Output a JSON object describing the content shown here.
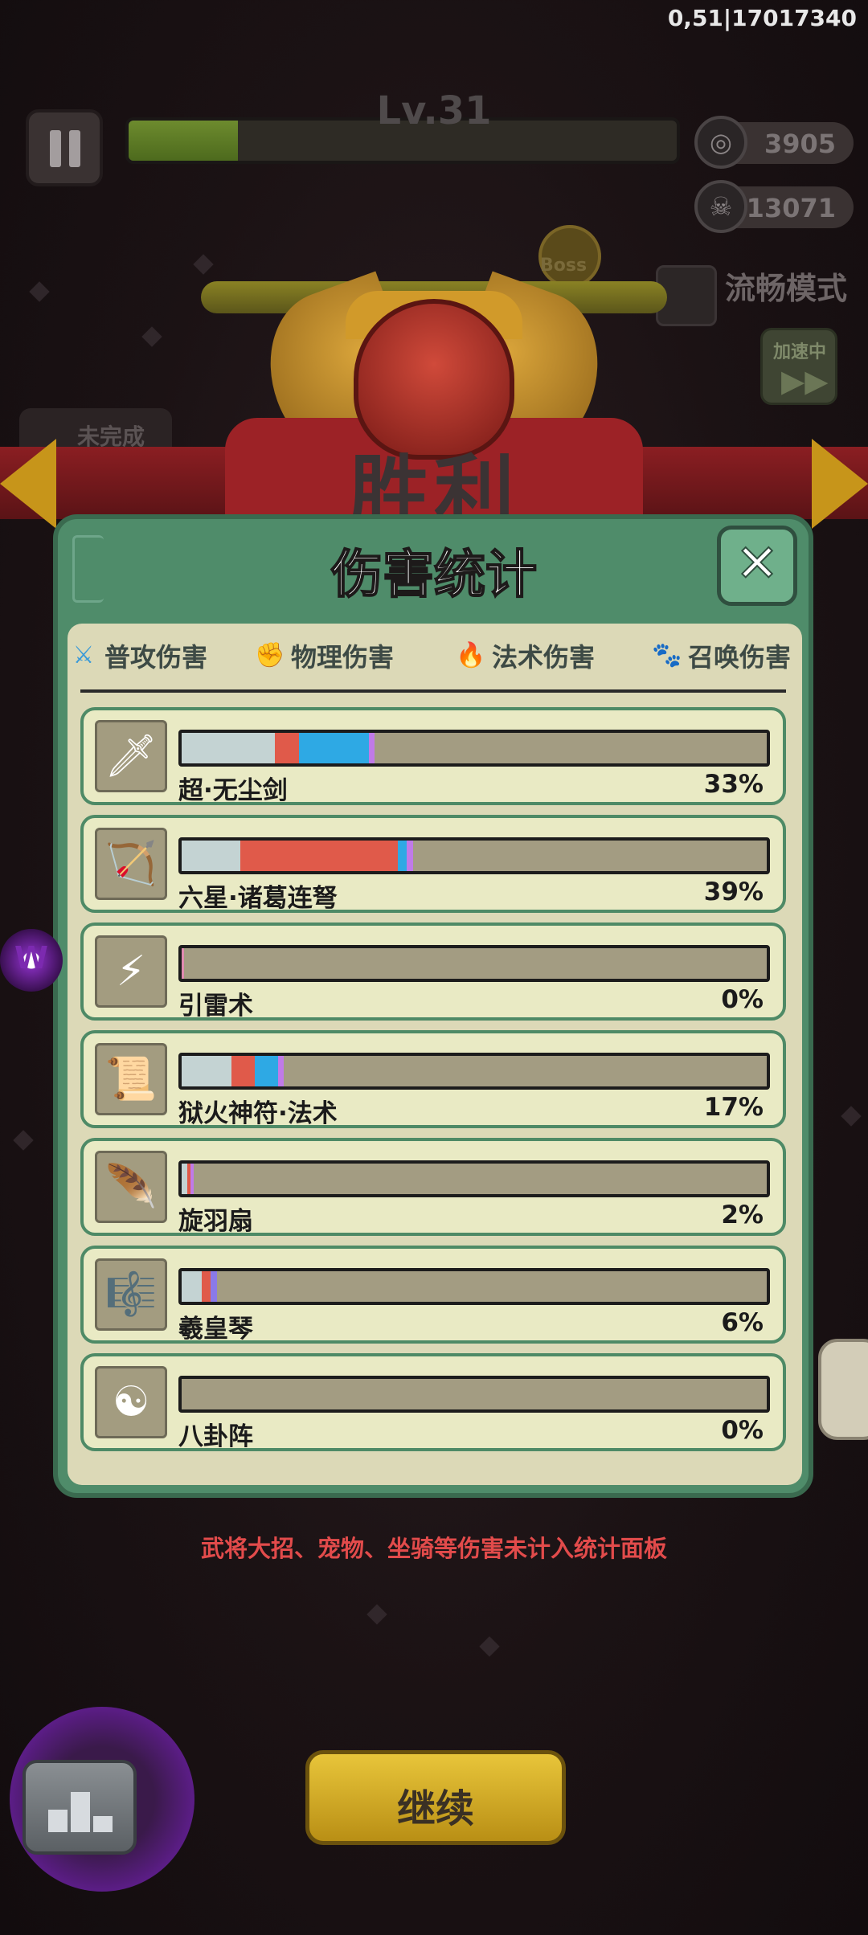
{
  "hud": {
    "version": "0,51|17017340",
    "level": "Lv.31",
    "xp_progress": 0.2,
    "currency": "3905",
    "kills": "13071",
    "smooth_mode": "流畅模式",
    "speed_label": "加速中",
    "speed_arrow": "▶▶",
    "unfinished": "未完成",
    "boss": "Boss"
  },
  "banner": {
    "title": "胜利"
  },
  "panel": {
    "title": "伤害统计",
    "close_icon": "✕",
    "tabs": [
      {
        "label": "普攻伤害",
        "icon": "sword-icon",
        "glyph": "⚔",
        "color": "#3a9ad8"
      },
      {
        "label": "物理伤害",
        "icon": "fist-icon",
        "glyph": "✊",
        "color": "#d83a3a"
      },
      {
        "label": "法术伤害",
        "icon": "flame-icon",
        "glyph": "🔥",
        "color": "#2a7ad8"
      },
      {
        "label": "召唤伤害",
        "icon": "paw-icon",
        "glyph": "🐾",
        "color": "#c23ad0"
      }
    ],
    "rows": [
      {
        "name": "超·无尘剑",
        "percent": "33%",
        "icon": "sword-skill-icon",
        "glyph": "🗡",
        "segments": [
          {
            "color": "#c4d3d3",
            "value": 16
          },
          {
            "color": "#e05a4a",
            "value": 4
          },
          {
            "color": "#2ea9e4",
            "value": 12
          },
          {
            "color": "#c07ae8",
            "value": 1
          }
        ]
      },
      {
        "name": "六星·诸葛连弩",
        "percent": "39%",
        "icon": "crossbow-icon",
        "glyph": "🏹",
        "segments": [
          {
            "color": "#c4d3d3",
            "value": 10
          },
          {
            "color": "#e05a4a",
            "value": 27
          },
          {
            "color": "#2ea9e4",
            "value": 1.5
          },
          {
            "color": "#c07ae8",
            "value": 1
          }
        ]
      },
      {
        "name": "引雷术",
        "percent": "0%",
        "icon": "lightning-icon",
        "glyph": "⚡",
        "segments": [
          {
            "color": "#e08ab0",
            "value": 0.4
          }
        ]
      },
      {
        "name": "狱火神符·法术",
        "percent": "17%",
        "icon": "talisman-icon",
        "glyph": "📜",
        "segments": [
          {
            "color": "#c4d3d3",
            "value": 8.5
          },
          {
            "color": "#e05a4a",
            "value": 4
          },
          {
            "color": "#2ea9e4",
            "value": 4
          },
          {
            "color": "#c07ae8",
            "value": 1
          }
        ]
      },
      {
        "name": "旋羽扇",
        "percent": "2%",
        "icon": "feather-fan-icon",
        "glyph": "🪶",
        "segments": [
          {
            "color": "#c4d3d3",
            "value": 1
          },
          {
            "color": "#e05a4a",
            "value": 0.5
          },
          {
            "color": "#c07ae8",
            "value": 0.5
          }
        ]
      },
      {
        "name": "羲皇琴",
        "percent": "6%",
        "icon": "zither-icon",
        "glyph": "🎼",
        "segments": [
          {
            "color": "#c4d3d3",
            "value": 3.5
          },
          {
            "color": "#e05a4a",
            "value": 1.5
          },
          {
            "color": "#8a7ae8",
            "value": 1
          }
        ]
      },
      {
        "name": "八卦阵",
        "percent": "0%",
        "icon": "bagua-icon",
        "glyph": "☯",
        "segments": []
      }
    ]
  },
  "notice": "武将大招、宠物、坐骑等伤害未计入统计面板",
  "buttons": {
    "continue": "继续"
  },
  "side_badge": "W"
}
